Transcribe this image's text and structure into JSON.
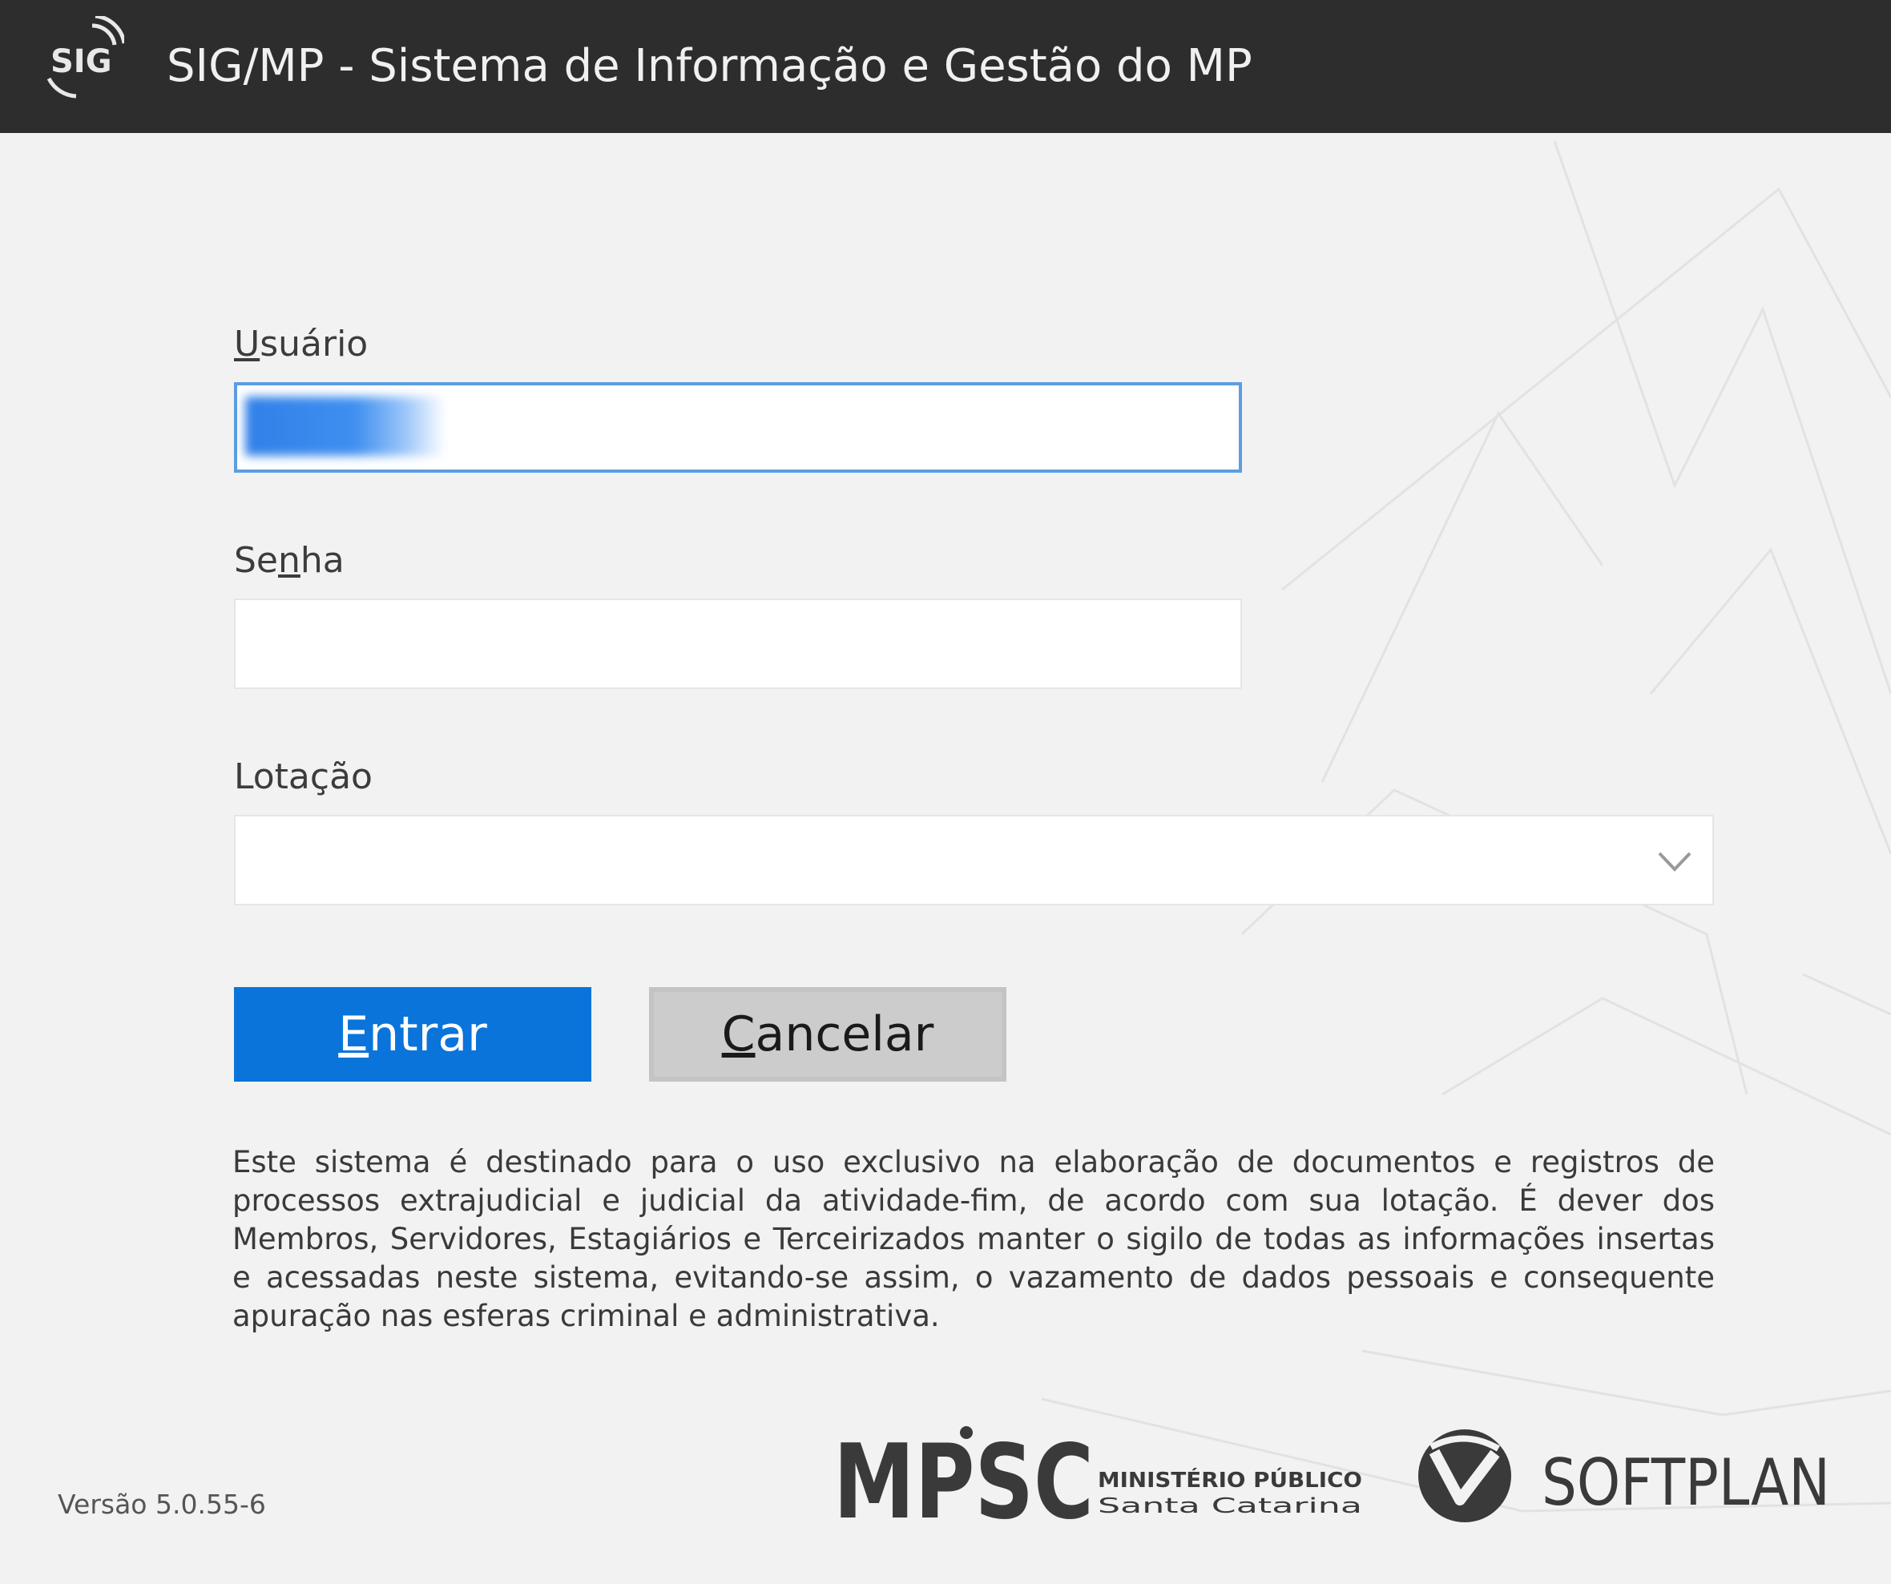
{
  "window": {
    "title": "SIG/MP - Sistema de Informação e Gestão do MP",
    "logo_text": "SIG"
  },
  "form": {
    "username": {
      "label_mnemonic": "U",
      "label_rest": "suário",
      "value": ""
    },
    "password": {
      "label_before": "Se",
      "label_mnemonic": "n",
      "label_after": "ha",
      "value": ""
    },
    "lotacao": {
      "label": "Lotação",
      "selected": ""
    }
  },
  "buttons": {
    "enter": {
      "mnemonic": "E",
      "rest": "ntrar"
    },
    "cancel": {
      "mnemonic": "C",
      "rest": "ancelar"
    }
  },
  "disclaimer": "Este sistema é destinado para o uso exclusivo na elaboração de documentos e registros de processos extrajudicial e judicial da atividade-fim, de acordo com sua lotação. É dever dos Membros, Servidores, Estagiários e Terceirizados manter o sigilo de todas as informações insertas e acessadas neste sistema, evitando-se assim, o vazamento de dados pessoais e consequente apuração nas esferas criminal e administrativa.",
  "version": "Versão 5.0.55-6",
  "logos": {
    "mpsc": {
      "main": "MPSC",
      "line1": "MINISTÉRIO PÚBLICO",
      "line2": "Santa Catarina"
    },
    "softplan": "SOFTPLAN"
  },
  "colors": {
    "titlebar": "#2d2d2d",
    "primary_button": "#0a74da",
    "secondary_button": "#cccccc",
    "focus_border": "#5b9ee0",
    "background": "#f2f2f2"
  },
  "icons": [
    "sig-logo-icon",
    "chevron-down-icon",
    "mpsc-logo",
    "softplan-logo"
  ]
}
